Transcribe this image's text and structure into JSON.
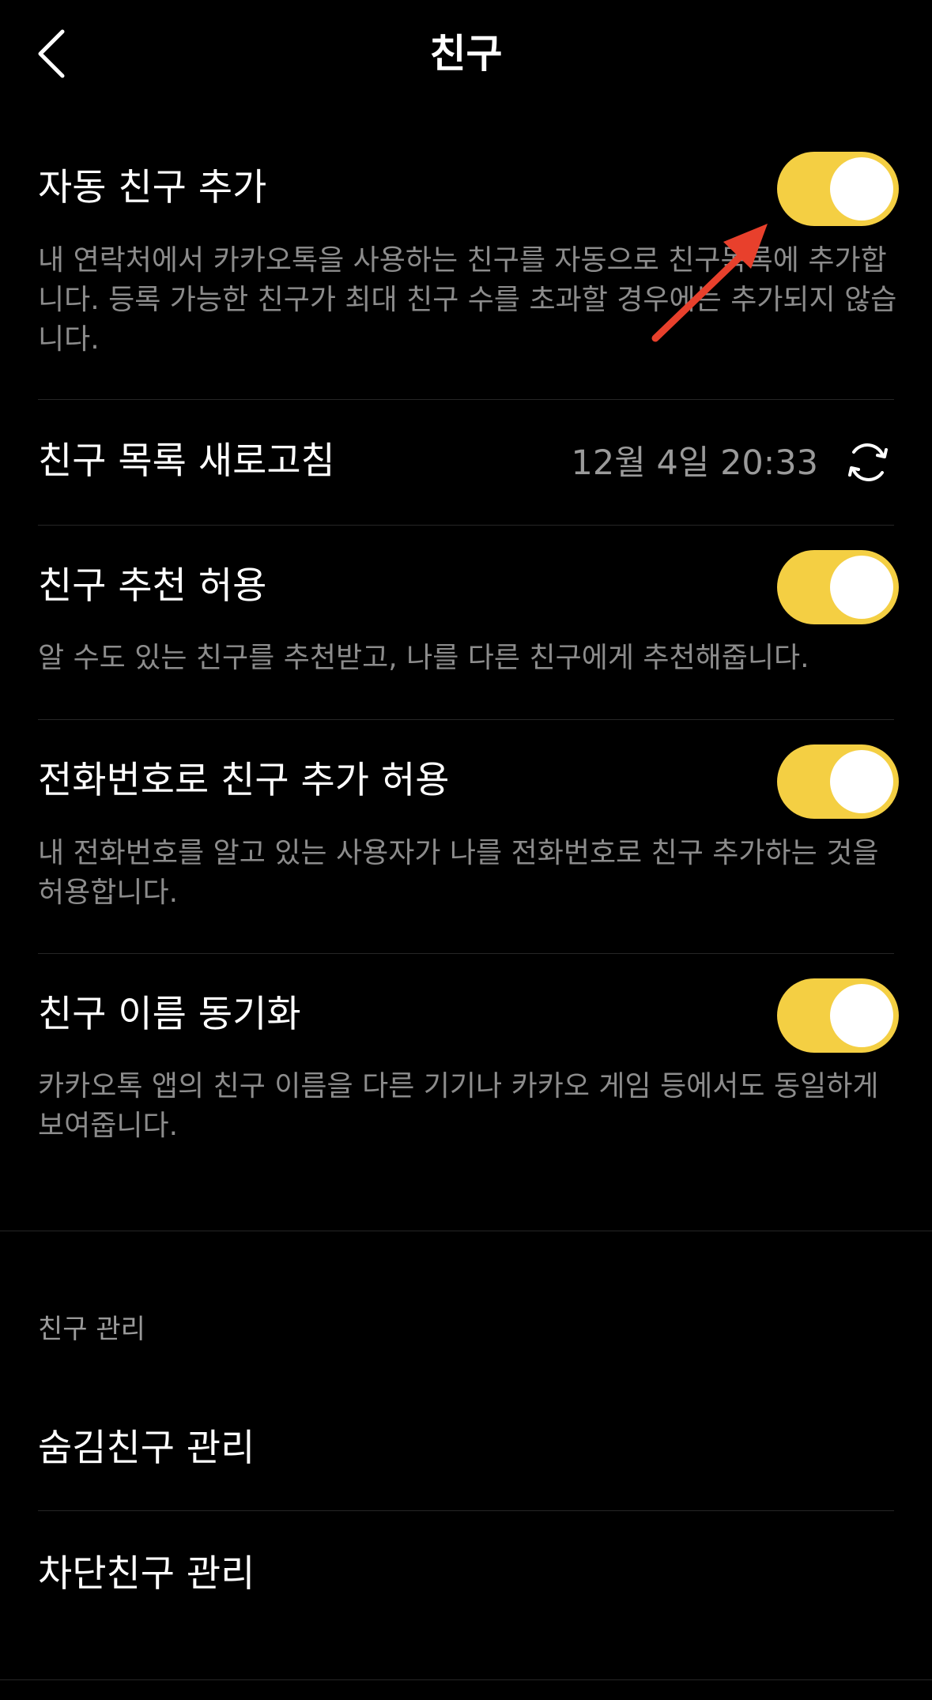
{
  "nav": {
    "title": "친구",
    "back_icon": "chevron-left-icon"
  },
  "colors": {
    "toggle_on": "#F4CF43",
    "description_text": "#8C8C8C",
    "annotation_arrow": "#E8402C"
  },
  "settings": {
    "auto_add": {
      "title": "자동 친구 추가",
      "description": "내 연락처에서 카카오톡을 사용하는 친구를 자동으로 친구목록에 추가합니다. 등록 가능한 친구가 최대 친구 수를 초과할 경우에는 추가되지 않습니다.",
      "enabled": true
    },
    "refresh": {
      "title": "친구 목록 새로고침",
      "timestamp": "12월 4일 20:33",
      "icon": "refresh-icon"
    },
    "recommend": {
      "title": "친구 추천 허용",
      "description": "알 수도 있는 친구를 추천받고, 나를 다른 친구에게 추천해줍니다.",
      "enabled": true
    },
    "phone_add": {
      "title": "전화번호로 친구 추가 허용",
      "description": "내 전화번호를 알고 있는 사용자가 나를 전화번호로 친구 추가하는 것을 허용합니다.",
      "enabled": true
    },
    "name_sync": {
      "title": "친구 이름 동기화",
      "description": "카카오톡 앱의 친구 이름을 다른 기기나 카카오 게임 등에서도 동일하게 보여줍니다.",
      "enabled": true
    }
  },
  "manage": {
    "header": "친구 관리",
    "hidden_friends": "숨김친구 관리",
    "blocked_friends": "차단친구 관리"
  }
}
